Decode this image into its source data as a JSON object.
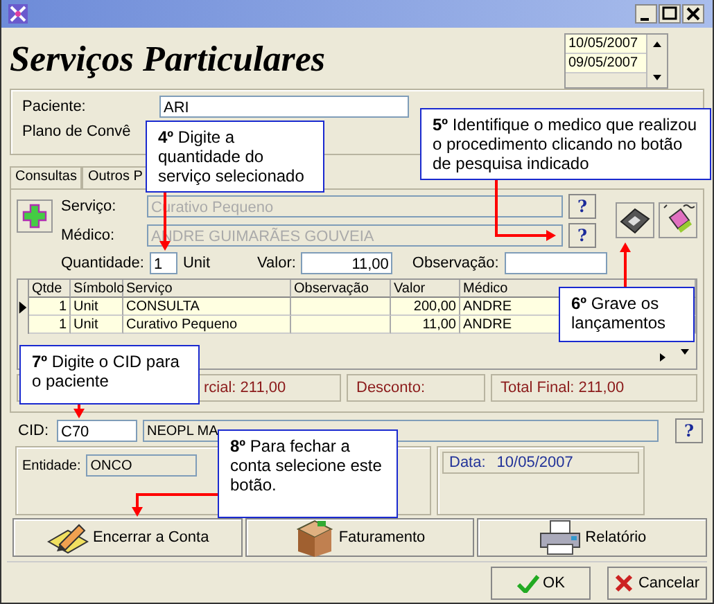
{
  "header": {
    "title": "Serviços Particulares",
    "dates": [
      {
        "text": "10/05/2007"
      },
      {
        "text": "09/05/2007"
      }
    ]
  },
  "patient": {
    "paciente_label": "Paciente:",
    "paciente_value": "ARI",
    "plano_label": "Plano de Convê"
  },
  "tabs": [
    {
      "label": "Consultas",
      "selected": false
    },
    {
      "label": "Outros P",
      "selected": false
    }
  ],
  "service_form": {
    "servico_label": "Serviço:",
    "servico_value": "Curativo Pequeno",
    "medico_label": "Médico:",
    "medico_value": "ANDRE GUIMARÃES GOUVEIA",
    "disabled": true,
    "lookup_buttons": [
      "?",
      "?"
    ],
    "quantidade_label": "Quantidade:",
    "quantidade_value": "1",
    "unit": "Unit",
    "valor_label": "Valor:",
    "valor_value": "11,00",
    "observacao_label": "Observação:"
  },
  "table": {
    "columns": [
      "Qtde",
      "Símbolo",
      "Serviço",
      "Observação",
      "Valor",
      "Médico"
    ],
    "rows": [
      {
        "selected": true,
        "qtde": "1",
        "simbolo": "Unit",
        "servico": "CONSULTA",
        "valor": "200,00",
        "medico": "ANDRE"
      },
      {
        "selected": false,
        "qtde": "1",
        "simbolo": "Unit",
        "servico": "Curativo Pequeno",
        "valor": "11,00",
        "medico": "ANDRE"
      }
    ]
  },
  "totals": [
    {
      "text": "rcial: 211,00"
    },
    {
      "text": "Desconto:"
    },
    {
      "text": "Total Final: 211,00"
    }
  ],
  "cid": {
    "label": "CID:",
    "code": "C70",
    "description": "NEOPL MA",
    "lookup": "?"
  },
  "entidade": {
    "label": "Entidade:",
    "value": "ONCO"
  },
  "data": {
    "label": "Data:",
    "value": "10/05/2007"
  },
  "actions": [
    {
      "label": "Encerrar a Conta",
      "kind": "close-account"
    },
    {
      "label": "Faturamento",
      "kind": "billing"
    },
    {
      "label": "Relatório",
      "kind": "report"
    }
  ],
  "dialog_buttons": [
    {
      "label": "OK",
      "kind": "ok"
    },
    {
      "label": "Cancelar",
      "kind": "cancel"
    }
  ],
  "callouts": [
    {
      "text": "**4º** Digite a quantidade do serviço selecionado"
    },
    {
      "text": "**5º** Identifique o medico que realizou o procedimento clicando no botão de pesquisa indicado"
    },
    {
      "text": "**6º** Grave os lançamentos"
    },
    {
      "text": "**7º** Digite o CID para o paciente"
    },
    {
      "text": "**8º** Para fechar a conta selecione este botão."
    }
  ]
}
